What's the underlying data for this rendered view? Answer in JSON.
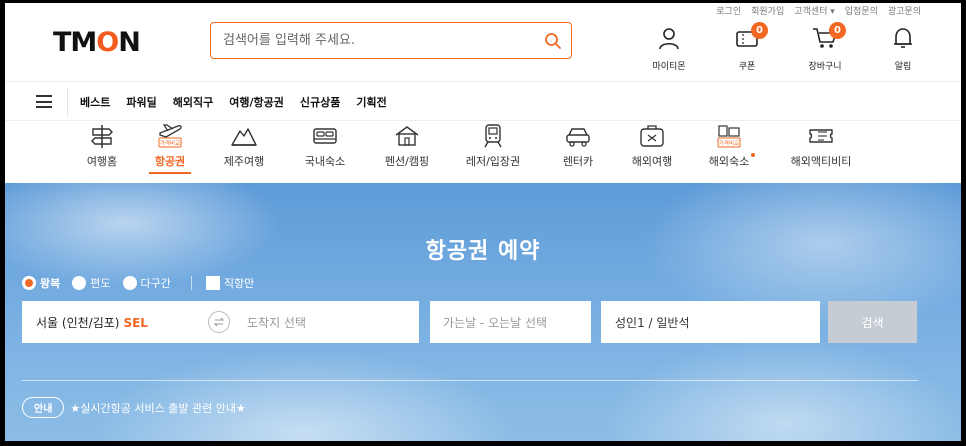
{
  "util_links": [
    "로그인",
    "회원가입",
    "고객센터 ▾",
    "입점문의",
    "광고문의"
  ],
  "logo": {
    "pre": "TM",
    "o": "O",
    "post": "N"
  },
  "search": {
    "placeholder": "검색어를 입력해 주세요."
  },
  "header_icons": [
    {
      "name": "mypage",
      "label": "마이티몬"
    },
    {
      "name": "coupon",
      "label": "쿠폰",
      "badge": "0"
    },
    {
      "name": "cart",
      "label": "장바구니",
      "badge": "0"
    },
    {
      "name": "alarm",
      "label": "알림"
    }
  ],
  "nav": [
    "베스트",
    "파워딜",
    "해외직구",
    "여행/항공권",
    "신규상품",
    "기획전"
  ],
  "categories": [
    {
      "label": "여행홈",
      "icon": "signpost-icon"
    },
    {
      "label": "항공권",
      "icon": "plane-icon",
      "active": true,
      "tag": "가격비교"
    },
    {
      "label": "제주여행",
      "icon": "hallasan-icon"
    },
    {
      "label": "국내숙소",
      "icon": "bed-icon"
    },
    {
      "label": "펜션/캠핑",
      "icon": "house-icon"
    },
    {
      "label": "레저/입장권",
      "icon": "train-icon"
    },
    {
      "label": "렌터카",
      "icon": "car-icon"
    },
    {
      "label": "해외여행",
      "icon": "suitcase-icon"
    },
    {
      "label": "해외숙소",
      "icon": "hotel-icon",
      "dot": true,
      "tag": "가격비교"
    },
    {
      "label": "해외액티비티",
      "icon": "ticket-icon"
    }
  ],
  "hero": {
    "title": "항공권 예약",
    "trip_types": [
      {
        "label": "왕복",
        "selected": true
      },
      {
        "label": "편도",
        "selected": false
      },
      {
        "label": "다구간",
        "selected": false
      }
    ],
    "direct_only": "직항만",
    "from_value": "서울 (인천/김포)",
    "from_code": "SEL",
    "to_placeholder": "도착지 선택",
    "date_placeholder": "가는날 - 오는날 선택",
    "passenger": "성인1 / 일반석",
    "search_button": "검색",
    "notice_tag": "안내",
    "notice_text": "★실시간항공 서비스 출발 관련 안내★"
  },
  "colors": {
    "accent": "#f26722",
    "sky": "#6fa7de",
    "button_disabled": "#c5ccd3"
  }
}
